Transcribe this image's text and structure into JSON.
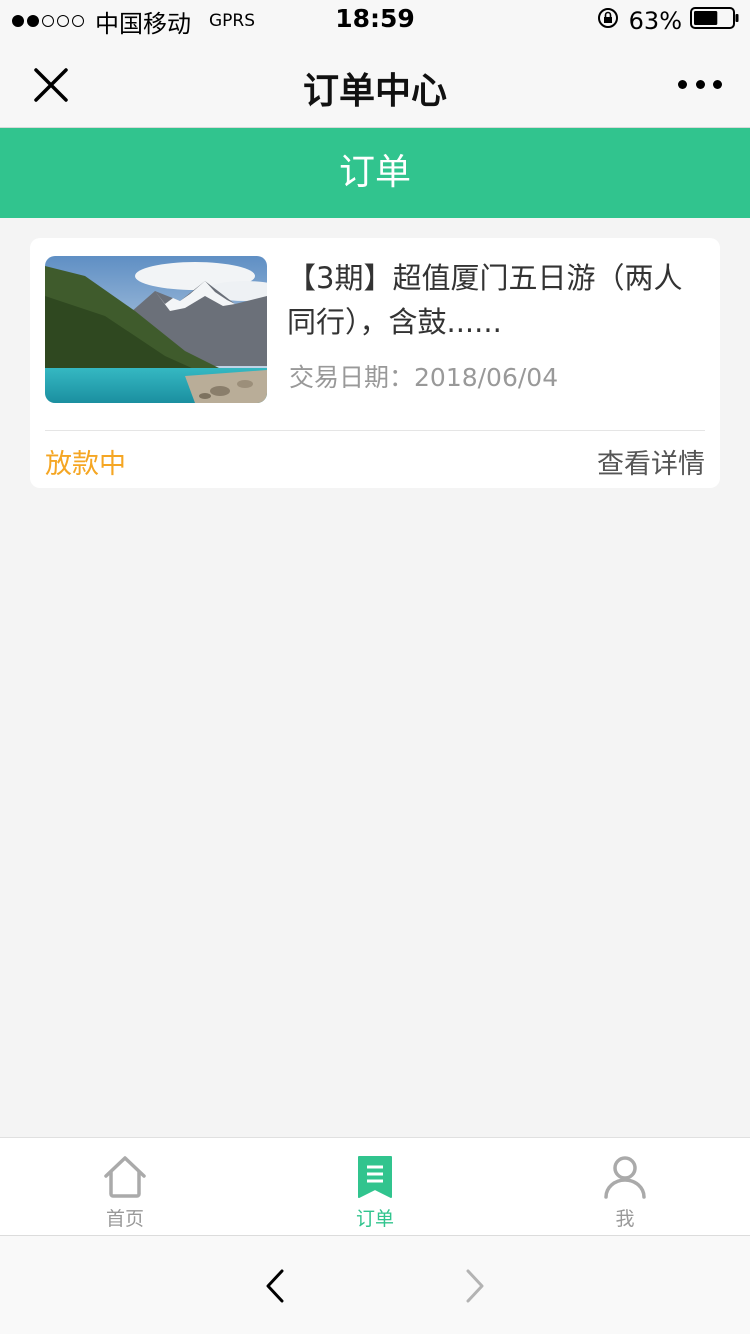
{
  "status_bar": {
    "carrier": "中国移动",
    "network": "GPRS",
    "time": "18:59",
    "battery": "63%",
    "battery_level": 0.63
  },
  "nav": {
    "title": "订单中心"
  },
  "section_header": {
    "title": "订单"
  },
  "orders": [
    {
      "title": "【3期】超值厦门五日游（两人同行），含鼓......",
      "date_label": "交易日期：",
      "date": "2018/06/04",
      "status": "放款中",
      "detail_link": "查看详情"
    }
  ],
  "tab_bar": {
    "items": [
      {
        "label": "首页",
        "icon": "home-icon",
        "active": false
      },
      {
        "label": "订单",
        "icon": "order-icon",
        "active": true
      },
      {
        "label": "我",
        "icon": "user-icon",
        "active": false
      }
    ]
  },
  "colors": {
    "accent": "#31c48e",
    "status_pending": "#f5a623"
  }
}
